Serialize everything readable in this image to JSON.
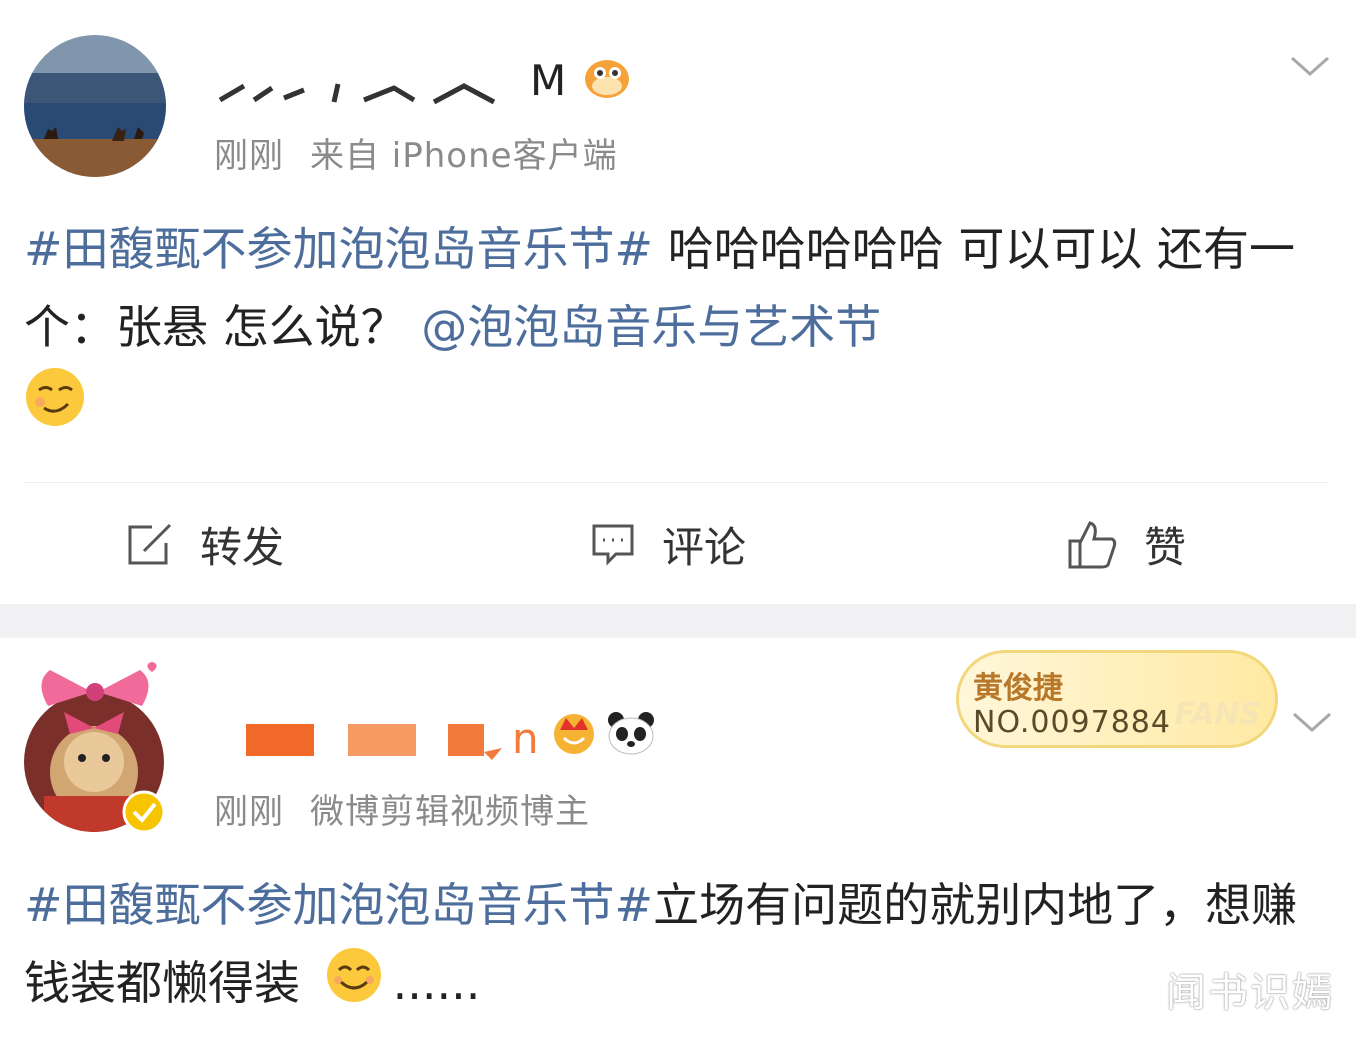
{
  "post1": {
    "username_visible": "M",
    "time": "刚刚",
    "source": "来自 iPhone客户端",
    "content": {
      "hashtag": "#田馥甄不参加泡泡岛音乐节#",
      "text": " 哈哈哈哈哈哈 可以可以 还有一个：张悬  怎么说？",
      "mention": "@泡泡岛音乐与艺术节"
    },
    "actions": {
      "repost": "转发",
      "comment": "评论",
      "like": "赞"
    }
  },
  "post2": {
    "username_visible": "n",
    "time": "刚刚",
    "source": "微博剪辑视频博主",
    "fan_badge": {
      "name": "黄俊捷",
      "number": "NO.0097884",
      "label": "FANS"
    },
    "content": {
      "hashtag": "#田馥甄不参加泡泡岛音乐节#",
      "text": "立场有问题的就别内地了，想赚钱装都懒得装",
      "ellipsis": "......"
    }
  },
  "watermark": "闻书识嫣",
  "colors": {
    "link": "#4d6e9c",
    "meta": "#8a8a8a",
    "separator": "#f1f1f3",
    "badge": "#ffe9a3"
  }
}
